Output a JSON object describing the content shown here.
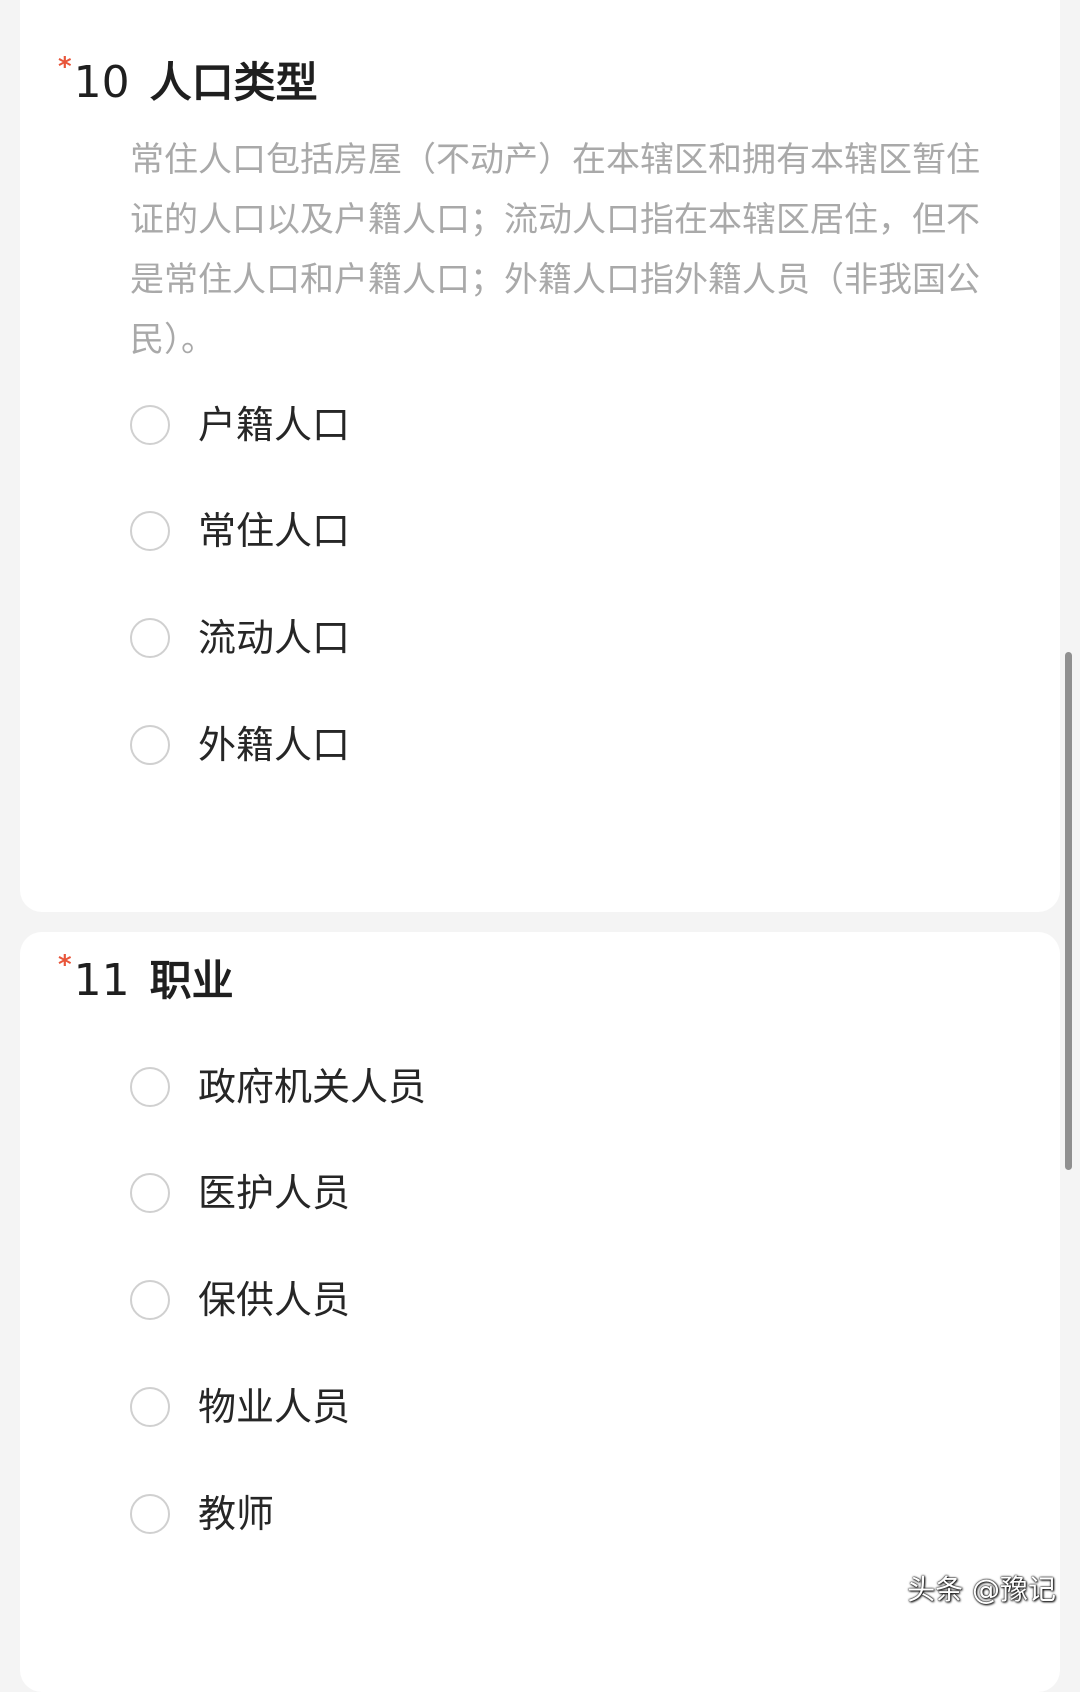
{
  "question10": {
    "required_mark": "*",
    "number": "10",
    "title": "人口类型",
    "description": "常住人口包括房屋（不动产）在本辖区和拥有本辖区暂住证的人口以及户籍人口；流动人口指在本辖区居住，但不是常住人口和户籍人口；外籍人口指外籍人员（非我国公民）。",
    "options": [
      {
        "label": "户籍人口"
      },
      {
        "label": "常住人口"
      },
      {
        "label": "流动人口"
      },
      {
        "label": "外籍人口"
      }
    ]
  },
  "question11": {
    "required_mark": "*",
    "number": "11",
    "title": "职业",
    "options": [
      {
        "label": "政府机关人员"
      },
      {
        "label": "医护人员"
      },
      {
        "label": "保供人员"
      },
      {
        "label": "物业人员"
      },
      {
        "label": "教师"
      }
    ]
  },
  "watermark": "头条 @豫记",
  "colors": {
    "required_mark": "#e8553a",
    "background": "#f4f4f4",
    "card": "#ffffff",
    "description": "#a9a9a9"
  }
}
